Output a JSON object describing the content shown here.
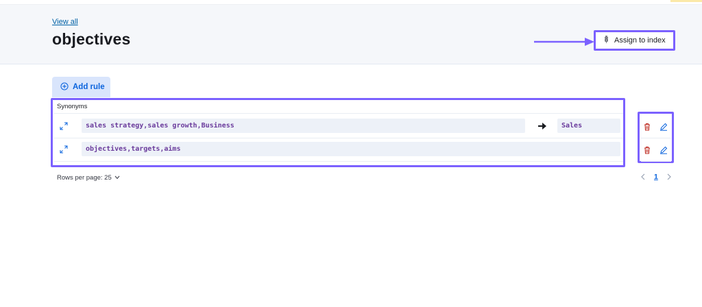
{
  "header": {
    "back_link": "View all",
    "title": "objectives",
    "assign_label": "Assign to index"
  },
  "toolbar": {
    "add_rule_label": "Add rule"
  },
  "table": {
    "column_header": "Synonyms",
    "rows": [
      {
        "synonyms": "sales strategy,sales growth,Business",
        "has_mapping": true,
        "mapped_to": "Sales"
      },
      {
        "synonyms": "objectives,targets,aims",
        "has_mapping": false,
        "mapped_to": ""
      }
    ]
  },
  "pagination": {
    "rows_per_page_label": "Rows per page: 25",
    "current_page": "1"
  },
  "icons": {
    "assign": "index-assign-icon",
    "add_rule": "plus-circle-icon",
    "expand": "expand-icon",
    "mapping": "arrow-right-icon",
    "delete": "trash-icon",
    "edit": "pencil-icon",
    "dropdown": "chevron-down-icon",
    "prev": "chevron-left-icon",
    "next": "chevron-right-icon"
  },
  "colors": {
    "annotation_purple": "#7b61ff",
    "link_blue": "#0b64dd",
    "code_purple": "#6a3b9c",
    "delete_red": "#bd271e",
    "header_bg": "#f5f7fa"
  }
}
